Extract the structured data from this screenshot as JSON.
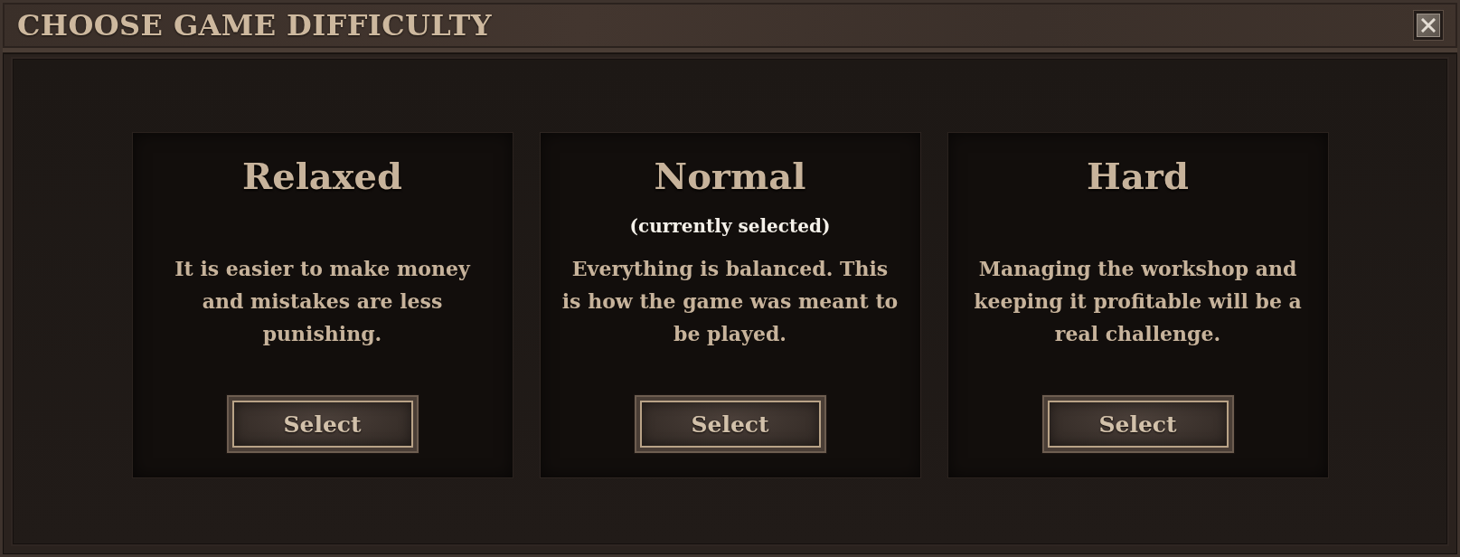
{
  "window": {
    "title": "CHOOSE GAME DIFFICULTY"
  },
  "selected_note": "(currently selected)",
  "options": [
    {
      "name": "Relaxed",
      "selected": false,
      "description": "It is easier to make money\nand mistakes are less\npunishing.",
      "button": "Select"
    },
    {
      "name": "Normal",
      "selected": true,
      "description": "Everything is balanced. This\nis how the game was meant to\nbe played.",
      "button": "Select"
    },
    {
      "name": "Hard",
      "selected": false,
      "description": "Managing the workshop and\nkeeping it profitable will be a\nreal challenge.",
      "button": "Select"
    }
  ]
}
